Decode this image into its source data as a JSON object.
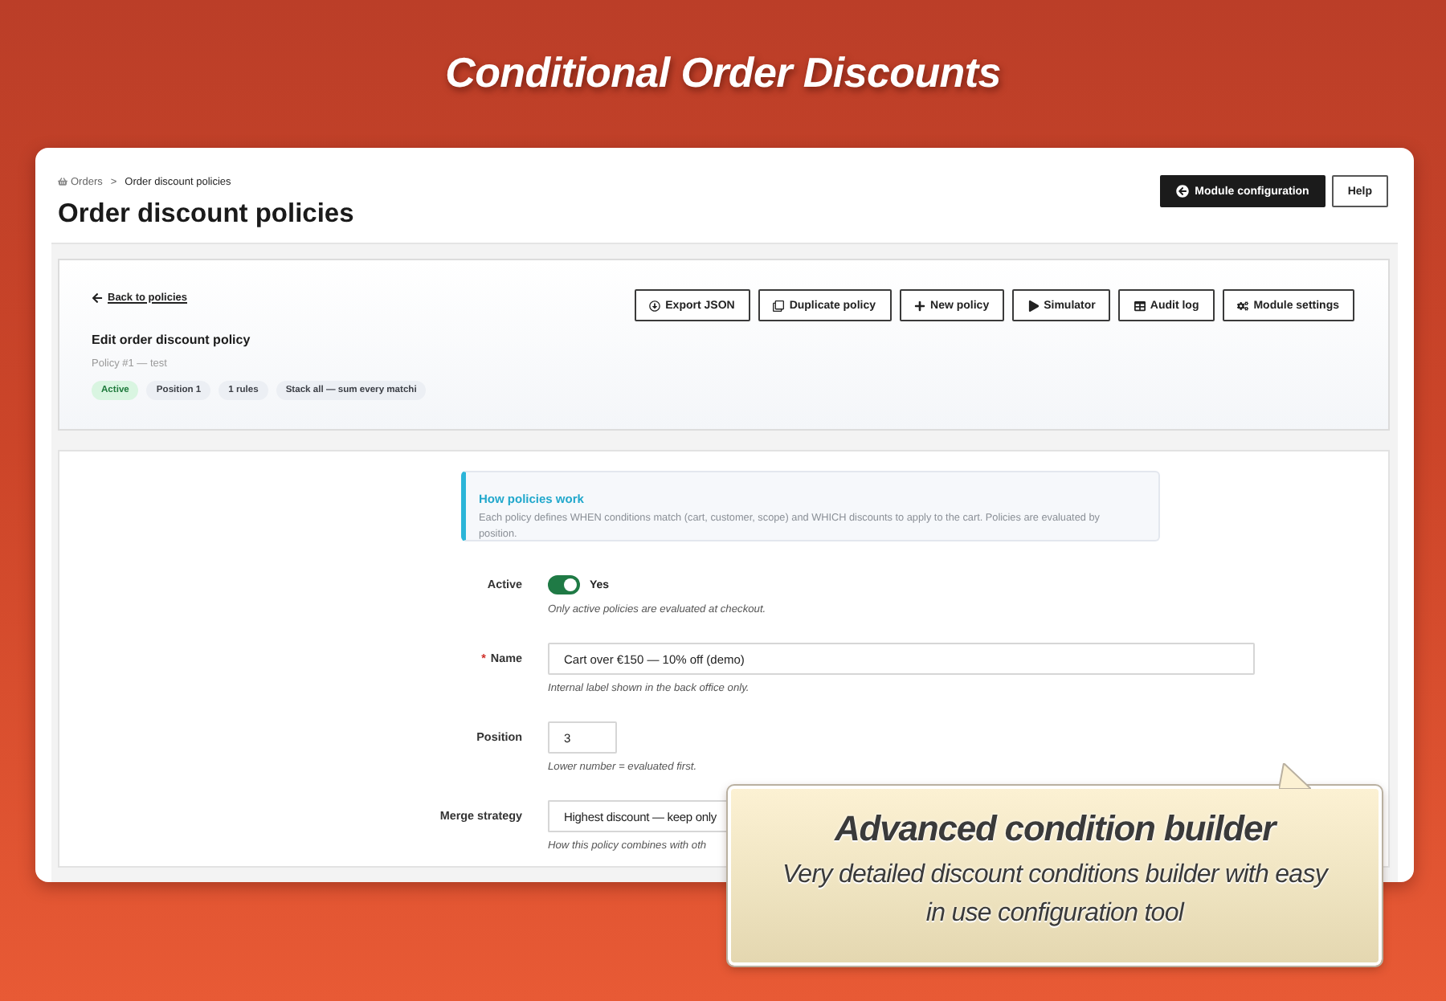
{
  "banner": {
    "title": "Conditional Order Discounts"
  },
  "header": {
    "breadcrumb": {
      "items": [
        "Orders",
        "Order discount policies"
      ],
      "separator": ">"
    },
    "title": "Order discount policies",
    "actions": [
      {
        "label": "Module configuration",
        "kind": "primary"
      },
      {
        "label": "Help",
        "kind": "secondary"
      }
    ]
  },
  "policy_card": {
    "back_link": "Back to policies",
    "toolbar": [
      "Export JSON",
      "Duplicate policy",
      "New policy",
      "Simulator",
      "Audit log",
      "Module settings"
    ],
    "title": "Edit order discount policy",
    "subtitle": "Policy #1 — test",
    "badges": [
      {
        "label": "Active",
        "kind": "success"
      },
      {
        "label": "Position 1",
        "kind": "neutral"
      },
      {
        "label": "1 rules",
        "kind": "neutral"
      },
      {
        "label": "Stack all — sum every matchi",
        "kind": "neutral"
      }
    ]
  },
  "info": {
    "title": "How policies work",
    "text": "Each policy defines WHEN conditions match (cart, customer, scope) and WHICH discounts to apply to the cart. Policies are evaluated by position."
  },
  "form": {
    "fields": [
      {
        "kind": "toggle",
        "label": "Active",
        "on": true,
        "value": "Yes",
        "help": "Only active policies are evaluated at checkout."
      },
      {
        "kind": "text",
        "label": "Name",
        "required_mark": "*",
        "value": "Cart over €150 — 10% off (demo)",
        "help": "Internal label shown in the back office only."
      },
      {
        "kind": "number",
        "label": "Position",
        "value": "3",
        "help": "Lower number = evaluated first."
      },
      {
        "kind": "select",
        "label": "Merge strategy",
        "value": "Highest discount — keep only",
        "help": "How this policy combines with oth"
      }
    ]
  },
  "callout": {
    "title": "Advanced condition builder",
    "text": "Very detailed discount conditions builder with easy in use configuration tool"
  }
}
